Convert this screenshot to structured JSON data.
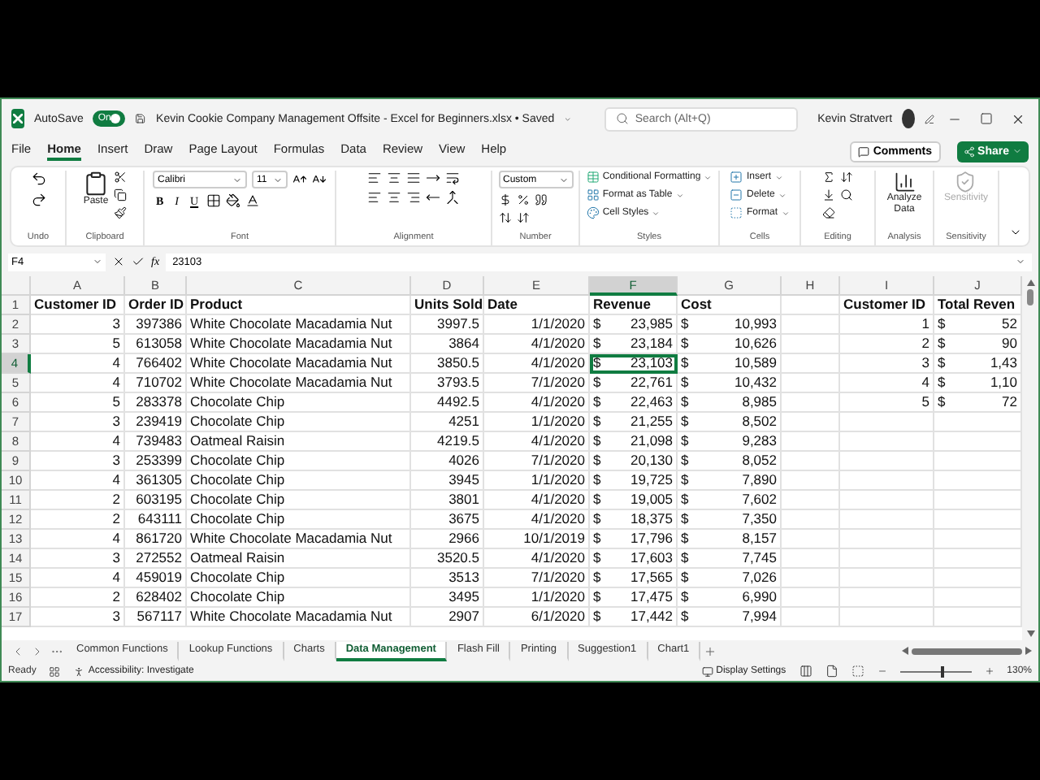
{
  "title_bar": {
    "autosave_label": "AutoSave",
    "autosave": {
      "on": true,
      "label": "On"
    },
    "title": "Kevin Cookie Company Management Offsite - Excel for Beginners.xlsx • Saved",
    "search": {
      "placeholder": "Search (Alt+Q)"
    },
    "user": "Kevin Stratvert"
  },
  "menu_tabs": [
    {
      "label": "File",
      "selected": false
    },
    {
      "label": "Home",
      "selected": true
    },
    {
      "label": "Insert",
      "selected": false
    },
    {
      "label": "Draw",
      "selected": false
    },
    {
      "label": "Page Layout",
      "selected": false
    },
    {
      "label": "Formulas",
      "selected": false
    },
    {
      "label": "Data",
      "selected": false
    },
    {
      "label": "Review",
      "selected": false
    },
    {
      "label": "View",
      "selected": false
    },
    {
      "label": "Help",
      "selected": false
    }
  ],
  "comments_button": "Comments",
  "share_button": "Share",
  "ribbon": {
    "undo_label": "Undo",
    "clipboard": {
      "label": "Clipboard",
      "paste": "Paste"
    },
    "font": {
      "label": "Font",
      "name": "Calibri",
      "size": "11",
      "styles": [
        {
          "label": "B",
          "kind": "bold"
        },
        {
          "label": "I",
          "kind": "italic"
        },
        {
          "label": "U",
          "kind": "underline"
        }
      ]
    },
    "alignment_label": "Alignment",
    "number": {
      "label": "Number",
      "format": "Custom"
    },
    "styles": {
      "label": "Styles",
      "items": [
        "Conditional Formatting",
        "Format as Table",
        "Cell Styles"
      ]
    },
    "cells": {
      "label": "Cells",
      "items": [
        "Insert",
        "Delete",
        "Format"
      ]
    },
    "editing_label": "Editing",
    "analysis": {
      "label": "Analysis",
      "button": "Analyze Data"
    },
    "sensitivity": {
      "label": "Sensitivity",
      "button": "Sensitivity",
      "disabled": true
    }
  },
  "formula_bar": {
    "name_box": "F4",
    "function_label": "fx",
    "formula": "23103"
  },
  "columns": [
    {
      "letter": "A",
      "selected": false
    },
    {
      "letter": "B",
      "selected": false
    },
    {
      "letter": "C",
      "selected": false
    },
    {
      "letter": "D",
      "selected": false
    },
    {
      "letter": "E",
      "selected": false
    },
    {
      "letter": "F",
      "selected": true
    },
    {
      "letter": "G",
      "selected": false
    },
    {
      "letter": "H",
      "selected": false
    },
    {
      "letter": "I",
      "selected": false
    },
    {
      "letter": "J",
      "selected": false
    }
  ],
  "rows": [
    {
      "number": "1",
      "selected": false,
      "cells": [
        {
          "kind": "head",
          "value": "Customer ID"
        },
        {
          "kind": "head",
          "value": "Order ID"
        },
        {
          "kind": "head",
          "value": "Product"
        },
        {
          "kind": "head",
          "value": "Units Sold"
        },
        {
          "kind": "head",
          "value": "Date"
        },
        {
          "kind": "head",
          "value": "Revenue"
        },
        {
          "kind": "head",
          "value": "Cost"
        },
        {
          "kind": "blank"
        },
        {
          "kind": "head",
          "value": "Customer ID"
        },
        {
          "kind": "head",
          "value": "Total Reven"
        }
      ]
    },
    {
      "number": "2",
      "selected": false,
      "cells": [
        {
          "kind": "num",
          "value": "3"
        },
        {
          "kind": "num",
          "value": "397386"
        },
        {
          "kind": "text",
          "value": "White Chocolate Macadamia Nut"
        },
        {
          "kind": "num",
          "value": "3997.5"
        },
        {
          "kind": "num",
          "value": "1/1/2020"
        },
        {
          "kind": "money",
          "symbol": "$",
          "value": "23,985"
        },
        {
          "kind": "money",
          "symbol": "$",
          "value": "10,993"
        },
        {
          "kind": "blank"
        },
        {
          "kind": "num",
          "value": "1"
        },
        {
          "kind": "money",
          "symbol": "$",
          "value": "52"
        }
      ]
    },
    {
      "number": "3",
      "selected": false,
      "cells": [
        {
          "kind": "num",
          "value": "5"
        },
        {
          "kind": "num",
          "value": "613058"
        },
        {
          "kind": "text",
          "value": "White Chocolate Macadamia Nut"
        },
        {
          "kind": "num",
          "value": "3864"
        },
        {
          "kind": "num",
          "value": "4/1/2020"
        },
        {
          "kind": "money",
          "symbol": "$",
          "value": "23,184"
        },
        {
          "kind": "money",
          "symbol": "$",
          "value": "10,626"
        },
        {
          "kind": "blank"
        },
        {
          "kind": "num",
          "value": "2"
        },
        {
          "kind": "money",
          "symbol": "$",
          "value": "90"
        }
      ]
    },
    {
      "number": "4",
      "selected": true,
      "cells": [
        {
          "kind": "num",
          "value": "4"
        },
        {
          "kind": "num",
          "value": "766402"
        },
        {
          "kind": "text",
          "value": "White Chocolate Macadamia Nut"
        },
        {
          "kind": "num",
          "value": "3850.5"
        },
        {
          "kind": "num",
          "value": "4/1/2020"
        },
        {
          "kind": "money",
          "symbol": "$",
          "value": "23,103"
        },
        {
          "kind": "money",
          "symbol": "$",
          "value": "10,589"
        },
        {
          "kind": "blank"
        },
        {
          "kind": "num",
          "value": "3"
        },
        {
          "kind": "money",
          "symbol": "$",
          "value": "1,43"
        }
      ]
    },
    {
      "number": "5",
      "selected": false,
      "cells": [
        {
          "kind": "num",
          "value": "4"
        },
        {
          "kind": "num",
          "value": "710702"
        },
        {
          "kind": "text",
          "value": "White Chocolate Macadamia Nut"
        },
        {
          "kind": "num",
          "value": "3793.5"
        },
        {
          "kind": "num",
          "value": "7/1/2020"
        },
        {
          "kind": "money",
          "symbol": "$",
          "value": "22,761"
        },
        {
          "kind": "money",
          "symbol": "$",
          "value": "10,432"
        },
        {
          "kind": "blank"
        },
        {
          "kind": "num",
          "value": "4"
        },
        {
          "kind": "money",
          "symbol": "$",
          "value": "1,10"
        }
      ]
    },
    {
      "number": "6",
      "selected": false,
      "cells": [
        {
          "kind": "num",
          "value": "5"
        },
        {
          "kind": "num",
          "value": "283378"
        },
        {
          "kind": "text",
          "value": "Chocolate Chip"
        },
        {
          "kind": "num",
          "value": "4492.5"
        },
        {
          "kind": "num",
          "value": "4/1/2020"
        },
        {
          "kind": "money",
          "symbol": "$",
          "value": "22,463"
        },
        {
          "kind": "money",
          "symbol": "$",
          "value": "8,985"
        },
        {
          "kind": "blank"
        },
        {
          "kind": "num",
          "value": "5"
        },
        {
          "kind": "money",
          "symbol": "$",
          "value": "72"
        }
      ]
    },
    {
      "number": "7",
      "selected": false,
      "cells": [
        {
          "kind": "num",
          "value": "3"
        },
        {
          "kind": "num",
          "value": "239419"
        },
        {
          "kind": "text",
          "value": "Chocolate Chip"
        },
        {
          "kind": "num",
          "value": "4251"
        },
        {
          "kind": "num",
          "value": "1/1/2020"
        },
        {
          "kind": "money",
          "symbol": "$",
          "value": "21,255"
        },
        {
          "kind": "money",
          "symbol": "$",
          "value": "8,502"
        },
        {
          "kind": "blank"
        },
        {
          "kind": "blank"
        },
        {
          "kind": "blank"
        }
      ]
    },
    {
      "number": "8",
      "selected": false,
      "cells": [
        {
          "kind": "num",
          "value": "4"
        },
        {
          "kind": "num",
          "value": "739483"
        },
        {
          "kind": "text",
          "value": "Oatmeal Raisin"
        },
        {
          "kind": "num",
          "value": "4219.5"
        },
        {
          "kind": "num",
          "value": "4/1/2020"
        },
        {
          "kind": "money",
          "symbol": "$",
          "value": "21,098"
        },
        {
          "kind": "money",
          "symbol": "$",
          "value": "9,283"
        },
        {
          "kind": "blank"
        },
        {
          "kind": "blank"
        },
        {
          "kind": "blank"
        }
      ]
    },
    {
      "number": "9",
      "selected": false,
      "cells": [
        {
          "kind": "num",
          "value": "3"
        },
        {
          "kind": "num",
          "value": "253399"
        },
        {
          "kind": "text",
          "value": "Chocolate Chip"
        },
        {
          "kind": "num",
          "value": "4026"
        },
        {
          "kind": "num",
          "value": "7/1/2020"
        },
        {
          "kind": "money",
          "symbol": "$",
          "value": "20,130"
        },
        {
          "kind": "money",
          "symbol": "$",
          "value": "8,052"
        },
        {
          "kind": "blank"
        },
        {
          "kind": "blank"
        },
        {
          "kind": "blank"
        }
      ]
    },
    {
      "number": "10",
      "selected": false,
      "cells": [
        {
          "kind": "num",
          "value": "4"
        },
        {
          "kind": "num",
          "value": "361305"
        },
        {
          "kind": "text",
          "value": "Chocolate Chip"
        },
        {
          "kind": "num",
          "value": "3945"
        },
        {
          "kind": "num",
          "value": "1/1/2020"
        },
        {
          "kind": "money",
          "symbol": "$",
          "value": "19,725"
        },
        {
          "kind": "money",
          "symbol": "$",
          "value": "7,890"
        },
        {
          "kind": "blank"
        },
        {
          "kind": "blank"
        },
        {
          "kind": "blank"
        }
      ]
    },
    {
      "number": "11",
      "selected": false,
      "cells": [
        {
          "kind": "num",
          "value": "2"
        },
        {
          "kind": "num",
          "value": "603195"
        },
        {
          "kind": "text",
          "value": "Chocolate Chip"
        },
        {
          "kind": "num",
          "value": "3801"
        },
        {
          "kind": "num",
          "value": "4/1/2020"
        },
        {
          "kind": "money",
          "symbol": "$",
          "value": "19,005"
        },
        {
          "kind": "money",
          "symbol": "$",
          "value": "7,602"
        },
        {
          "kind": "blank"
        },
        {
          "kind": "blank"
        },
        {
          "kind": "blank"
        }
      ]
    },
    {
      "number": "12",
      "selected": false,
      "cells": [
        {
          "kind": "num",
          "value": "2"
        },
        {
          "kind": "num",
          "value": "643111"
        },
        {
          "kind": "text",
          "value": "Chocolate Chip"
        },
        {
          "kind": "num",
          "value": "3675"
        },
        {
          "kind": "num",
          "value": "4/1/2020"
        },
        {
          "kind": "money",
          "symbol": "$",
          "value": "18,375"
        },
        {
          "kind": "money",
          "symbol": "$",
          "value": "7,350"
        },
        {
          "kind": "blank"
        },
        {
          "kind": "blank"
        },
        {
          "kind": "blank"
        }
      ]
    },
    {
      "number": "13",
      "selected": false,
      "cells": [
        {
          "kind": "num",
          "value": "4"
        },
        {
          "kind": "num",
          "value": "861720"
        },
        {
          "kind": "text",
          "value": "White Chocolate Macadamia Nut"
        },
        {
          "kind": "num",
          "value": "2966"
        },
        {
          "kind": "num",
          "value": "10/1/2019"
        },
        {
          "kind": "money",
          "symbol": "$",
          "value": "17,796"
        },
        {
          "kind": "money",
          "symbol": "$",
          "value": "8,157"
        },
        {
          "kind": "blank"
        },
        {
          "kind": "blank"
        },
        {
          "kind": "blank"
        }
      ]
    },
    {
      "number": "14",
      "selected": false,
      "cells": [
        {
          "kind": "num",
          "value": "3"
        },
        {
          "kind": "num",
          "value": "272552"
        },
        {
          "kind": "text",
          "value": "Oatmeal Raisin"
        },
        {
          "kind": "num",
          "value": "3520.5"
        },
        {
          "kind": "num",
          "value": "4/1/2020"
        },
        {
          "kind": "money",
          "symbol": "$",
          "value": "17,603"
        },
        {
          "kind": "money",
          "symbol": "$",
          "value": "7,745"
        },
        {
          "kind": "blank"
        },
        {
          "kind": "blank"
        },
        {
          "kind": "blank"
        }
      ]
    },
    {
      "number": "15",
      "selected": false,
      "cells": [
        {
          "kind": "num",
          "value": "4"
        },
        {
          "kind": "num",
          "value": "459019"
        },
        {
          "kind": "text",
          "value": "Chocolate Chip"
        },
        {
          "kind": "num",
          "value": "3513"
        },
        {
          "kind": "num",
          "value": "7/1/2020"
        },
        {
          "kind": "money",
          "symbol": "$",
          "value": "17,565"
        },
        {
          "kind": "money",
          "symbol": "$",
          "value": "7,026"
        },
        {
          "kind": "blank"
        },
        {
          "kind": "blank"
        },
        {
          "kind": "blank"
        }
      ]
    },
    {
      "number": "16",
      "selected": false,
      "cells": [
        {
          "kind": "num",
          "value": "2"
        },
        {
          "kind": "num",
          "value": "628402"
        },
        {
          "kind": "text",
          "value": "Chocolate Chip"
        },
        {
          "kind": "num",
          "value": "3495"
        },
        {
          "kind": "num",
          "value": "1/1/2020"
        },
        {
          "kind": "money",
          "symbol": "$",
          "value": "17,475"
        },
        {
          "kind": "money",
          "symbol": "$",
          "value": "6,990"
        },
        {
          "kind": "blank"
        },
        {
          "kind": "blank"
        },
        {
          "kind": "blank"
        }
      ]
    },
    {
      "number": "17",
      "selected": false,
      "cells": [
        {
          "kind": "num",
          "value": "3"
        },
        {
          "kind": "num",
          "value": "567117"
        },
        {
          "kind": "text",
          "value": "White Chocolate Macadamia Nut"
        },
        {
          "kind": "num",
          "value": "2907"
        },
        {
          "kind": "num",
          "value": "6/1/2020"
        },
        {
          "kind": "money",
          "symbol": "$",
          "value": "17,442"
        },
        {
          "kind": "money",
          "symbol": "$",
          "value": "7,994"
        },
        {
          "kind": "blank"
        },
        {
          "kind": "blank"
        },
        {
          "kind": "blank"
        }
      ]
    }
  ],
  "sheet_tabs": [
    {
      "label": "Common Functions",
      "selected": false
    },
    {
      "label": "Lookup Functions",
      "selected": false
    },
    {
      "label": "Charts",
      "selected": false
    },
    {
      "label": "Data Management",
      "selected": true
    },
    {
      "label": "Flash Fill",
      "selected": false
    },
    {
      "label": "Printing",
      "selected": false
    },
    {
      "label": "Suggestion1",
      "selected": false
    },
    {
      "label": "Chart1",
      "selected": false
    }
  ],
  "status_bar": {
    "ready": "Ready",
    "accessibility": "Accessibility: Investigate",
    "display_settings": "Display Settings",
    "zoom": {
      "level": 0.6,
      "reading": "130%"
    }
  }
}
